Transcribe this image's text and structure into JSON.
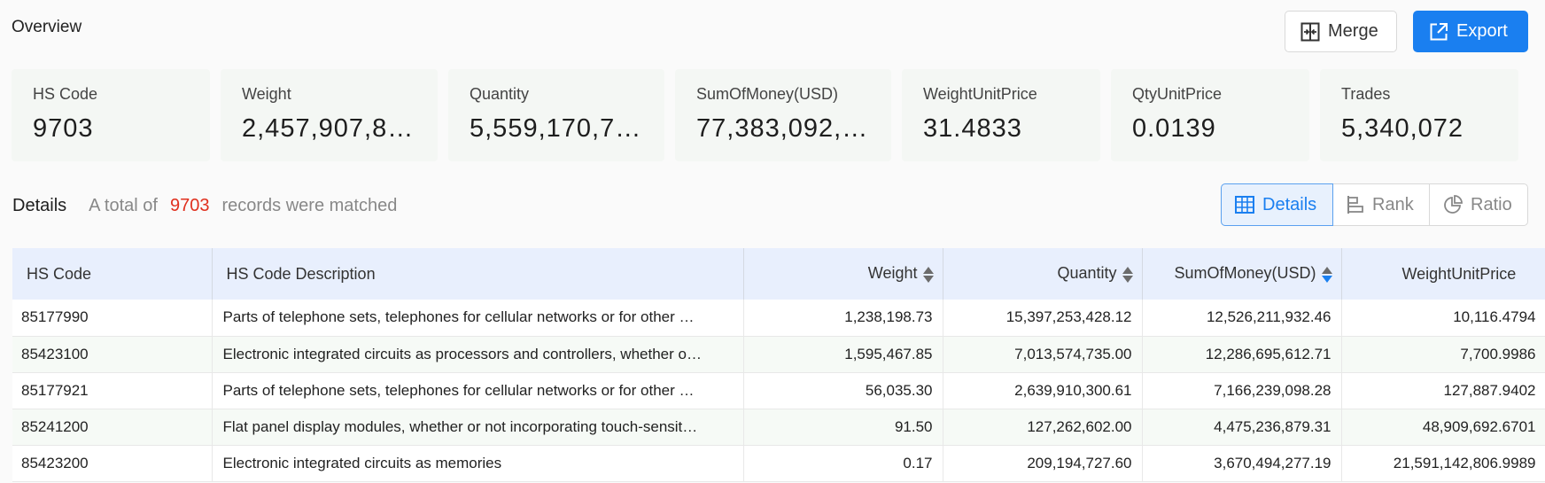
{
  "overview": {
    "title": "Overview",
    "merge_label": "Merge",
    "export_label": "Export"
  },
  "stats": [
    {
      "label": "HS Code",
      "value": "9703"
    },
    {
      "label": "Weight",
      "value": "2,457,907,8…"
    },
    {
      "label": "Quantity",
      "value": "5,559,170,7…"
    },
    {
      "label": "SumOfMoney(USD)",
      "value": "77,383,092,…"
    },
    {
      "label": "WeightUnitPrice",
      "value": "31.4833"
    },
    {
      "label": "QtyUnitPrice",
      "value": "0.0139"
    },
    {
      "label": "Trades",
      "value": "5,340,072"
    }
  ],
  "details": {
    "title": "Details",
    "prefix": "A total of",
    "count": "9703",
    "suffix": "records were matched",
    "tabs": {
      "details": "Details",
      "rank": "Rank",
      "ratio": "Ratio"
    }
  },
  "table": {
    "headers": [
      "HS Code",
      "HS Code Description",
      "Weight",
      "Quantity",
      "SumOfMoney(USD)",
      "WeightUnitPrice"
    ],
    "rows": [
      [
        "85177990",
        "Parts of telephone sets, telephones for cellular networks or for other …",
        "1,238,198.73",
        "15,397,253,428.12",
        "12,526,211,932.46",
        "10,116.4794"
      ],
      [
        "85423100",
        "Electronic integrated circuits as processors and controllers, whether o…",
        "1,595,467.85",
        "7,013,574,735.00",
        "12,286,695,612.71",
        "7,700.9986"
      ],
      [
        "85177921",
        "Parts of telephone sets, telephones for cellular networks or for other …",
        "56,035.30",
        "2,639,910,300.61",
        "7,166,239,098.28",
        "127,887.9402"
      ],
      [
        "85241200",
        "Flat panel display modules, whether or not incorporating touch-sensit…",
        "91.50",
        "127,262,602.00",
        "4,475,236,879.31",
        "48,909,692.6701"
      ],
      [
        "85423200",
        "Electronic integrated circuits as memories",
        "0.17",
        "209,194,727.60",
        "3,670,494,277.19",
        "21,591,142,806.9989"
      ]
    ]
  },
  "colors": {
    "accent": "#1a7ff0",
    "count": "#e0301e",
    "header_bg": "#e8effd"
  }
}
